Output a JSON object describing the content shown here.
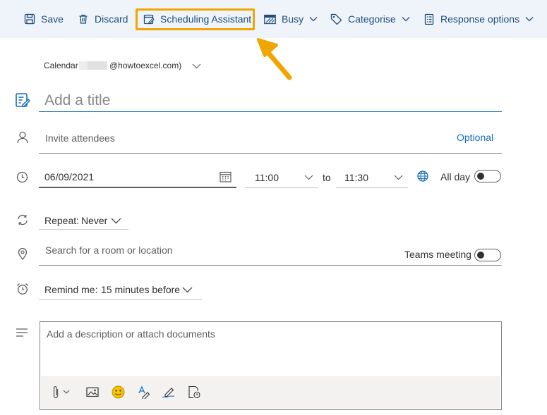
{
  "toolbar": {
    "save": "Save",
    "discard": "Discard",
    "scheduling_assistant": "Scheduling Assistant",
    "busy": "Busy",
    "categorise": "Categorise",
    "response_options": "Response options"
  },
  "calendar": {
    "prefix": "Calendar",
    "suffix": "@howtoexcel.com)"
  },
  "title": {
    "placeholder": "Add a title"
  },
  "attendees": {
    "placeholder": "Invite attendees",
    "optional": "Optional"
  },
  "datetime": {
    "date": "06/09/2021",
    "start": "11:00",
    "to": "to",
    "end": "11:30",
    "all_day": "All day"
  },
  "repeat": {
    "label": "Repeat:",
    "value": "Never"
  },
  "location": {
    "placeholder": "Search for a room or location",
    "teams_label": "Teams meeting"
  },
  "remind": {
    "label": "Remind me:",
    "value": "15 minutes before"
  },
  "description": {
    "placeholder": "Add a description or attach documents"
  },
  "colors": {
    "accent": "#0f6cbd",
    "highlight": "#f0a500",
    "toolbar_bg": "#eff4fb"
  }
}
